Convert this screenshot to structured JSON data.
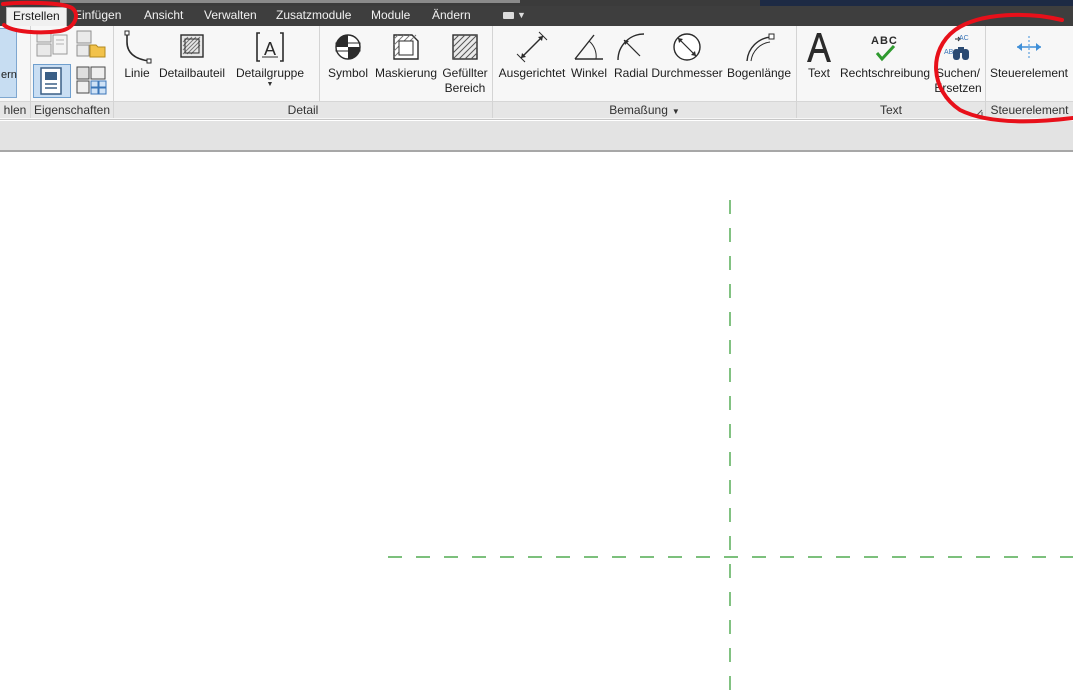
{
  "tabs": [
    "Erstellen",
    "Einfügen",
    "Ansicht",
    "Verwalten",
    "Zusatzmodule",
    "Module",
    "Ändern"
  ],
  "left_partial": {
    "button_label": "ern",
    "panel_label": "hlen"
  },
  "properties_panel": {
    "label": "Eigenschaften"
  },
  "detail_panel": {
    "label": "Detail",
    "tools": [
      "Linie",
      "Detailbauteil",
      "Detailgruppe",
      "Symbol",
      "Maskierung"
    ],
    "filled_region": {
      "line1": "Gefüllter",
      "line2": "Bereich"
    }
  },
  "dimension_panel": {
    "label": "Bemaßung",
    "tools": [
      "Ausgerichtet",
      "Winkel",
      "Radial",
      "Durchmesser",
      "Bogenlänge"
    ]
  },
  "text_panel": {
    "label": "Text",
    "tools": [
      "Text",
      "Rechtschreibung"
    ],
    "find_replace": {
      "line1": "Suchen/",
      "line2": "Ersetzen"
    },
    "spell_icon_text": "ABC",
    "find_icon_text_top": "AC",
    "find_icon_text_bottom": "AB"
  },
  "control_panel": {
    "label": "Steuerelement",
    "tool": "Steuerelement"
  },
  "colors": {
    "annotation_red": "#e8101a",
    "grid_green": "#2e9a2e",
    "accent_blue": "#3f8fd8"
  },
  "icons": [
    "detail-line-icon",
    "detail-component-icon",
    "detail-group-icon",
    "symbol-icon",
    "masking-region-icon",
    "filled-region-icon",
    "aligned-dimension-icon",
    "angular-dimension-icon",
    "radial-dimension-icon",
    "diameter-dimension-icon",
    "arc-length-dimension-icon",
    "text-icon",
    "spelling-icon",
    "find-replace-icon",
    "control-icon"
  ]
}
